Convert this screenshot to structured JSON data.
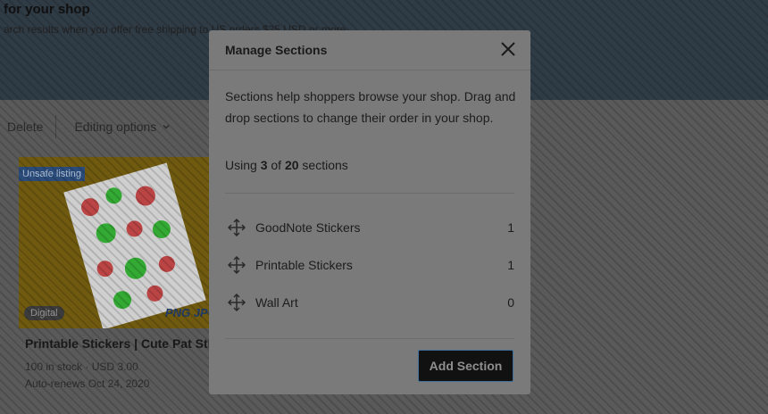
{
  "background": {
    "title": "for your shop",
    "subtitle": "arch results when you offer free shipping to US orders $35 USD or more",
    "toolbar": {
      "delete_label": "Delete",
      "editing_label": "Editing options"
    },
    "listing": {
      "badge_unsafe": "Unsafe listing",
      "badge_digital": "Digital",
      "image_text": "PNG JPG",
      "title": "Printable Stickers | Cute Pat Stickers",
      "stock": "100 in stock",
      "price": "USD 3.00",
      "renews": "Auto-renews Oct 24, 2020"
    }
  },
  "modal": {
    "title": "Manage Sections",
    "close_icon": "close-icon",
    "description": "Sections help shoppers browse your shop. Drag and drop sections to change their order in your shop.",
    "usage": {
      "prefix": "Using",
      "used": "3",
      "of": "of",
      "total": "20",
      "suffix": "sections"
    },
    "sections": [
      {
        "label": "GoodNote Stickers",
        "count": "1"
      },
      {
        "label": "Printable Stickers",
        "count": "1"
      },
      {
        "label": "Wall Art",
        "count": "0"
      }
    ],
    "add_button": "Add Section"
  },
  "colors": {
    "overlay": "#5c5c5c",
    "modal_bg": "#7a7a7a",
    "button_bg": "#111111",
    "button_border": "#3f6f9a"
  }
}
